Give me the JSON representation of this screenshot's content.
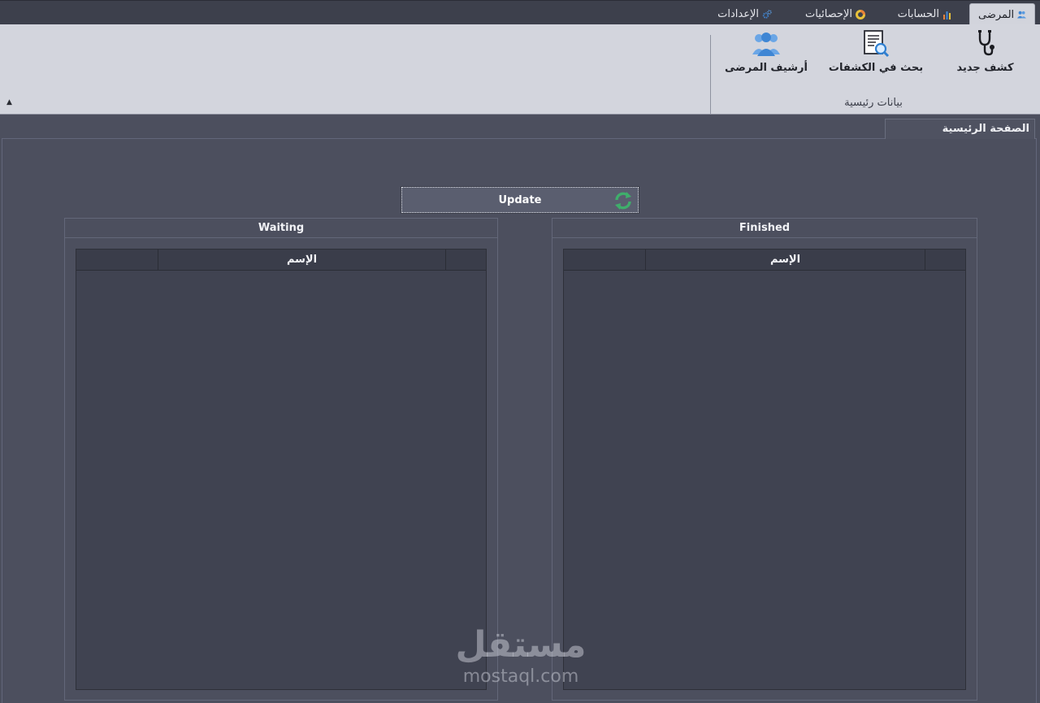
{
  "ribbon": {
    "tabs": [
      {
        "label": "المرضى",
        "icon": "patients-icon",
        "active": true
      },
      {
        "label": "الحسابات",
        "icon": "bar-chart-icon",
        "active": false
      },
      {
        "label": "الإحصائيات",
        "icon": "donut-chart-icon",
        "active": false
      },
      {
        "label": "الإعدادات",
        "icon": "gears-icon",
        "active": false
      }
    ],
    "buttons": {
      "new_exam": "كشف جديد",
      "search_exams": "بحث في الكشفات",
      "patients_archive": "أرشيف المرضى"
    },
    "group_label": "بيانات رئيسية"
  },
  "document": {
    "tab_label": "الصفحة الرئيسية",
    "update_label": "Update",
    "waiting": {
      "title": "Waiting",
      "name_column": "الإسم"
    },
    "finished": {
      "title": "Finished",
      "name_column": "الإسم"
    }
  },
  "watermark": {
    "arabic": "مستقل",
    "latin": "mostaql.com"
  },
  "colors": {
    "background": "#4c4f5e",
    "ribbon": "#d3d5dd",
    "grid": "#404351",
    "refresh_green": "#3fae6b",
    "icon_blue": "#3f86d4"
  }
}
